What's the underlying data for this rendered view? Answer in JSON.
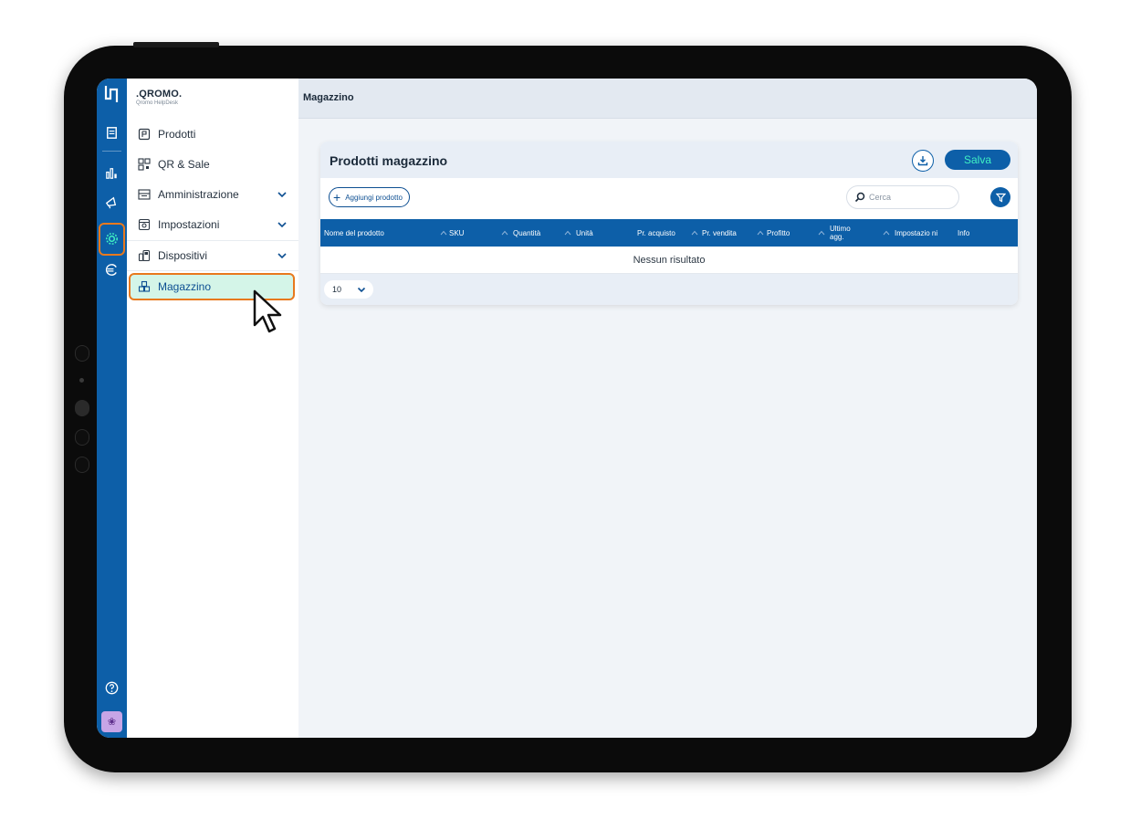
{
  "brand": {
    "name": ".QROMO.",
    "subtitle": "Qromo HelpDesk"
  },
  "header": {
    "title": "Magazzino"
  },
  "menu": {
    "items": [
      {
        "label": "Prodotti",
        "icon": "product-box-icon"
      },
      {
        "label": "QR & Sale",
        "icon": "qr-code-icon"
      },
      {
        "label": "Amministrazione",
        "icon": "register-icon",
        "expandable": true
      },
      {
        "label": "Impostazioni",
        "icon": "settings-drawer-icon",
        "expandable": true
      },
      {
        "label": "Dispositivi",
        "icon": "devices-icon",
        "expandable": true
      },
      {
        "label": "Magazzino",
        "icon": "warehouse-icon",
        "active": true
      }
    ]
  },
  "card": {
    "title": "Prodotti magazzino",
    "save_label": "Salva",
    "add_label": "Aggiungi prodotto",
    "search_placeholder": "Cerca",
    "columns": [
      "Nome del prodotto",
      "SKU",
      "Quantità",
      "Unità",
      "Pr. acquisto",
      "Pr. vendita",
      "Profitto",
      "Ultimo agg.",
      "Impostazio ni",
      "Info"
    ],
    "empty_text": "Nessun risultato",
    "page_size": "10"
  },
  "colors": {
    "primary": "#0d5fa8",
    "accent": "#3ff0c4",
    "highlight": "#e8791e",
    "active_bg": "#d4f5e8"
  }
}
